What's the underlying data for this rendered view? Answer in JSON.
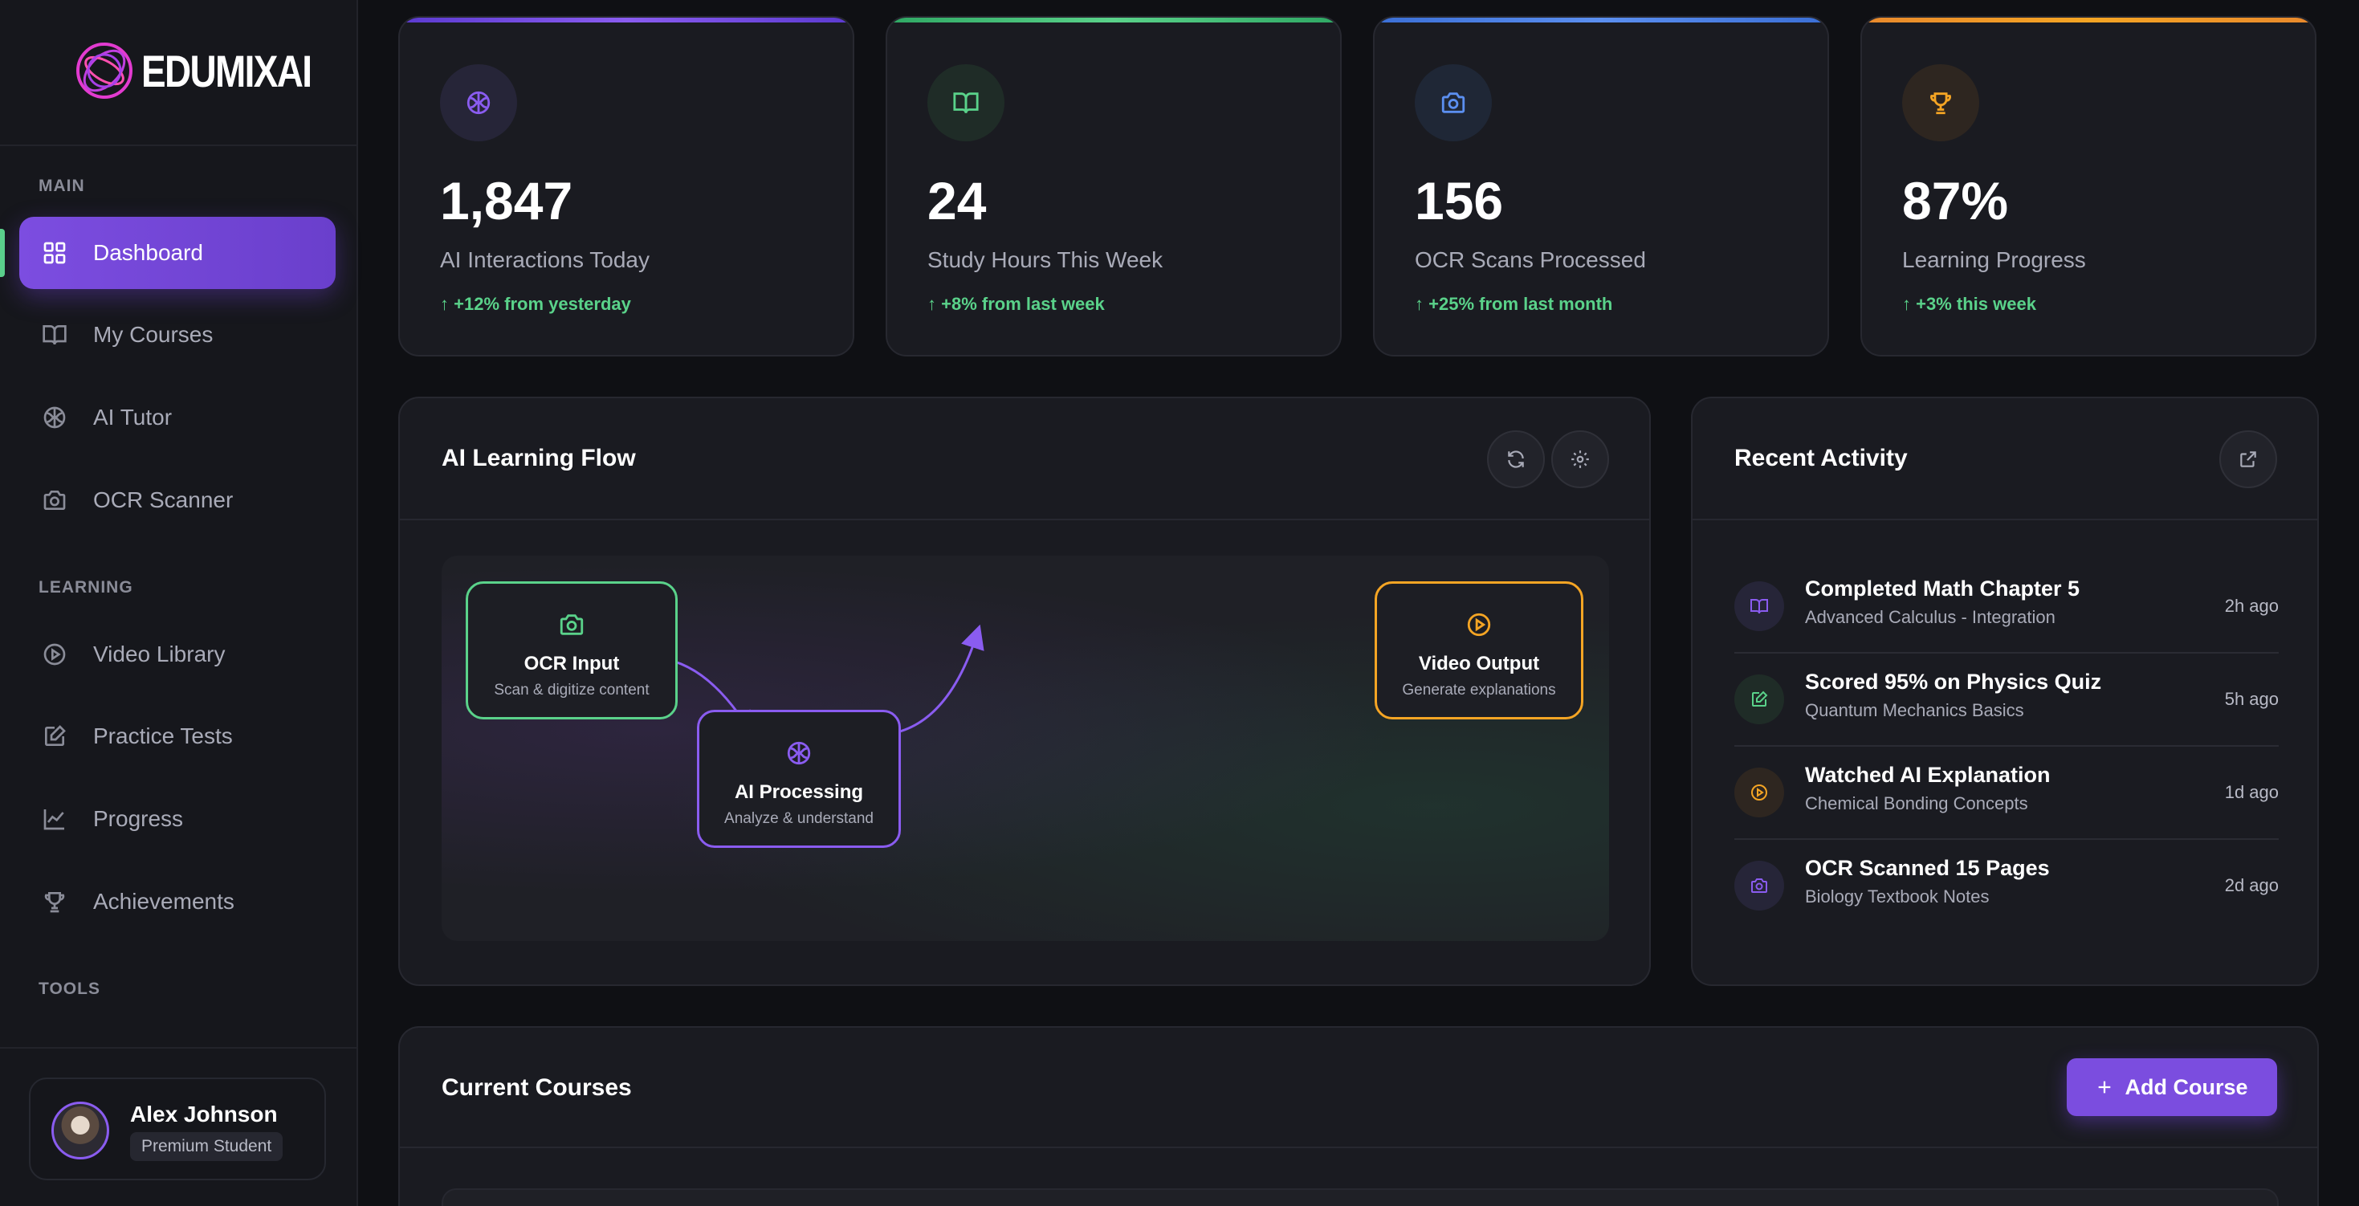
{
  "brand": {
    "name": "EDUMIXAI",
    "logo_icon": "orbit-rings-logo"
  },
  "sidebar": {
    "sections": [
      {
        "label": "MAIN"
      },
      {
        "label": "LEARNING"
      },
      {
        "label": "TOOLS"
      }
    ],
    "items": [
      {
        "label": "Dashboard",
        "icon": "grid-icon",
        "active": true
      },
      {
        "label": "My Courses",
        "icon": "book-icon"
      },
      {
        "label": "AI Tutor",
        "icon": "brain-icon"
      },
      {
        "label": "OCR Scanner",
        "icon": "camera-icon"
      },
      {
        "label": "Video Library",
        "icon": "play-circle-icon"
      },
      {
        "label": "Practice Tests",
        "icon": "edit-icon"
      },
      {
        "label": "Progress",
        "icon": "trend-icon"
      },
      {
        "label": "Achievements",
        "icon": "trophy-icon"
      }
    ],
    "profile": {
      "name": "Alex Johnson",
      "badge": "Premium Student"
    }
  },
  "stats": [
    {
      "value": "1,847",
      "label": "AI Interactions Today",
      "change": "+12% from yesterday",
      "accent": "#7c4dff",
      "icon": "brain-icon"
    },
    {
      "value": "24",
      "label": "Study Hours This Week",
      "change": "+8% from last week",
      "accent": "#4ade80",
      "icon": "book-open-icon"
    },
    {
      "value": "156",
      "label": "OCR Scans Processed",
      "change": "+25% from last month",
      "accent": "#3b82f6",
      "icon": "camera-icon"
    },
    {
      "value": "87%",
      "label": "Learning Progress",
      "change": "+3% this week",
      "accent": "#f59e0b",
      "icon": "trophy-icon"
    }
  ],
  "flow": {
    "title": "AI Learning Flow",
    "nodes": [
      {
        "title": "OCR Input",
        "subtitle": "Scan & digitize content",
        "color": "#5ad28a",
        "icon": "camera-icon"
      },
      {
        "title": "AI Processing",
        "subtitle": "Analyze & understand",
        "color": "#8a5cf0",
        "icon": "brain-icon"
      },
      {
        "title": "Video Output",
        "subtitle": "Generate explanations",
        "color": "#f5a524",
        "icon": "play-circle-icon"
      }
    ]
  },
  "activity": {
    "title": "Recent Activity",
    "items": [
      {
        "title": "Completed Math Chapter 5",
        "subtitle": "Advanced Calculus - Integration",
        "time": "2h ago",
        "icon": "book-icon",
        "color": "#8a5cf0"
      },
      {
        "title": "Scored 95% on Physics Quiz",
        "subtitle": "Quantum Mechanics Basics",
        "time": "5h ago",
        "icon": "edit-icon",
        "color": "#5ad28a"
      },
      {
        "title": "Watched AI Explanation",
        "subtitle": "Chemical Bonding Concepts",
        "time": "1d ago",
        "icon": "play-circle-icon",
        "color": "#f5a524"
      },
      {
        "title": "OCR Scanned 15 Pages",
        "subtitle": "Biology Textbook Notes",
        "time": "2d ago",
        "icon": "camera-icon",
        "color": "#8a5cf0"
      }
    ]
  },
  "courses": {
    "title": "Current Courses",
    "add_label": "Add Course"
  }
}
